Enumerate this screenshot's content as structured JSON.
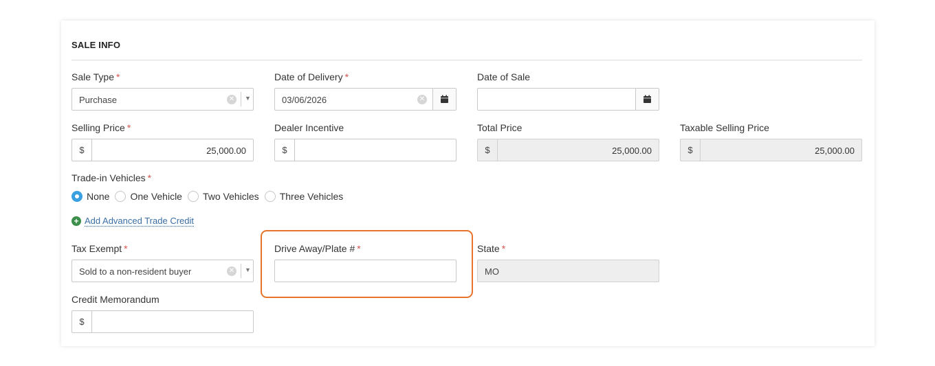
{
  "section": {
    "title": "SALE INFO"
  },
  "fields": {
    "sale_type": {
      "label": "Sale Type",
      "required_mark": "*",
      "value": "Purchase"
    },
    "date_of_delivery": {
      "label": "Date of Delivery",
      "required_mark": "*",
      "value": "03/06/2026"
    },
    "date_of_sale": {
      "label": "Date of Sale",
      "value": ""
    },
    "selling_price": {
      "label": "Selling Price",
      "required_mark": "*",
      "currency": "$",
      "value": "25,000.00"
    },
    "dealer_incentive": {
      "label": "Dealer Incentive",
      "currency": "$",
      "value": ""
    },
    "total_price": {
      "label": "Total Price",
      "currency": "$",
      "value": "25,000.00"
    },
    "taxable_selling_price": {
      "label": "Taxable Selling Price",
      "currency": "$",
      "value": "25,000.00"
    },
    "trade_in": {
      "label": "Trade-in Vehicles",
      "required_mark": "*",
      "options": [
        "None",
        "One Vehicle",
        "Two Vehicles",
        "Three Vehicles"
      ],
      "selected": "None"
    },
    "add_trade_credit": {
      "label": "Add Advanced Trade Credit"
    },
    "tax_exempt": {
      "label": "Tax Exempt",
      "required_mark": "*",
      "value": "Sold to a non-resident buyer"
    },
    "drive_away_plate": {
      "label": "Drive Away/Plate #",
      "required_mark": "*",
      "value": ""
    },
    "state": {
      "label": "State",
      "required_mark": "*",
      "value": "MO"
    },
    "credit_memorandum": {
      "label": "Credit Memorandum",
      "currency": "$",
      "value": ""
    }
  },
  "colors": {
    "required": "#d9534f",
    "radio_selected": "#3aa0e0",
    "highlight_border": "#e8732a",
    "add_icon": "#3c8f4a",
    "link": "#3a6ea5",
    "readonly_bg": "#eeeeee"
  },
  "icons": {
    "clear": "clear-circle-icon",
    "caret": "caret-down-icon",
    "calendar": "calendar-icon",
    "add": "plus-circle-icon"
  }
}
